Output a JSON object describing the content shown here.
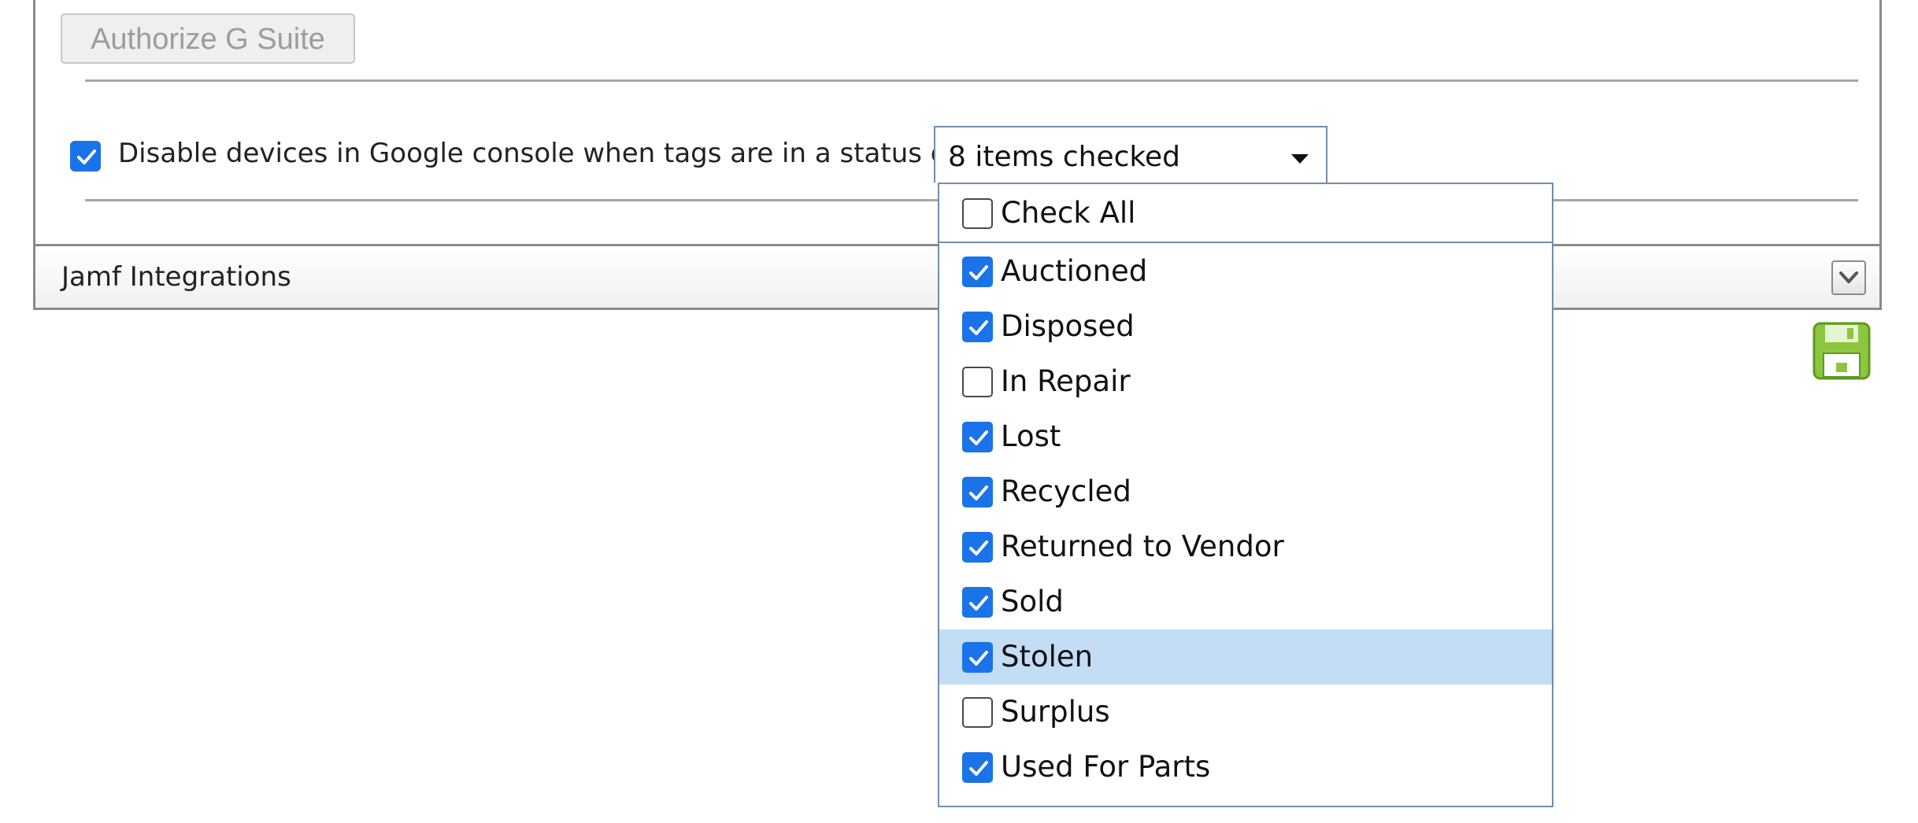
{
  "gsuite": {
    "authorize_label": "Authorize G Suite",
    "disable_devices": {
      "checked": true,
      "label": "Disable devices in Google console when tags are in a status of",
      "select_value": "8 items checked"
    }
  },
  "jamf_section": {
    "title": "Jamf Integrations"
  },
  "dropdown": {
    "check_all": {
      "label": "Check All",
      "checked": false
    },
    "options": [
      {
        "label": "Auctioned",
        "checked": true,
        "highlighted": false
      },
      {
        "label": "Disposed",
        "checked": true,
        "highlighted": false
      },
      {
        "label": "In Repair",
        "checked": false,
        "highlighted": false
      },
      {
        "label": "Lost",
        "checked": true,
        "highlighted": false
      },
      {
        "label": "Recycled",
        "checked": true,
        "highlighted": false
      },
      {
        "label": "Returned to Vendor",
        "checked": true,
        "highlighted": false
      },
      {
        "label": "Sold",
        "checked": true,
        "highlighted": false
      },
      {
        "label": "Stolen",
        "checked": true,
        "highlighted": true
      },
      {
        "label": "Surplus",
        "checked": false,
        "highlighted": false
      },
      {
        "label": "Used For Parts",
        "checked": true,
        "highlighted": false
      }
    ]
  },
  "icons": {
    "collapse": "chevron-down-icon",
    "save": "floppy-disk-icon",
    "check": "checkmark-icon"
  },
  "colors": {
    "checkbox_blue": "#1a73e8",
    "highlight_row": "#c2ddf4",
    "dropdown_border": "#6f8eaf",
    "save_icon_green": "#8cc63f"
  }
}
